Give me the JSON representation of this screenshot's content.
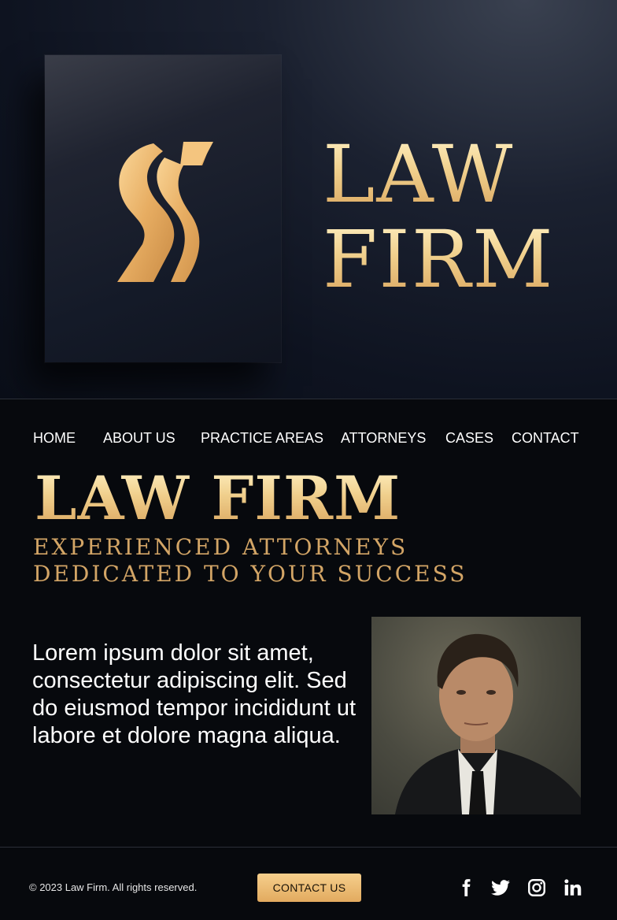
{
  "hero": {
    "title_line1": "LAW",
    "title_line2": "FIRM"
  },
  "nav": {
    "items": [
      "HOME",
      "ABOUT US",
      "PRACTICE AREAS",
      "ATTORNEYS",
      "CASES",
      "CONTACT"
    ]
  },
  "main": {
    "title": "LAW FIRM",
    "subtitle_line1": "EXPERIENCED ATTORNEYS",
    "subtitle_line2": "DEDICATED TO YOUR SUCCESS",
    "body_text": "Lorem ipsum dolor sit amet, consectetur adipiscing elit. Sed do eiusmod tempor incididunt ut labore et dolore magna aliqua."
  },
  "footer": {
    "copyright": "© 2023 Law Firm. All rights reserved.",
    "cta_label": "CONTACT US",
    "social_icons": [
      "facebook-icon",
      "twitter-icon",
      "instagram-icon",
      "linkedin-icon"
    ]
  },
  "colors": {
    "background": "#07090d",
    "gold": "#e2aa5f",
    "gold_light": "#fff1c4"
  }
}
